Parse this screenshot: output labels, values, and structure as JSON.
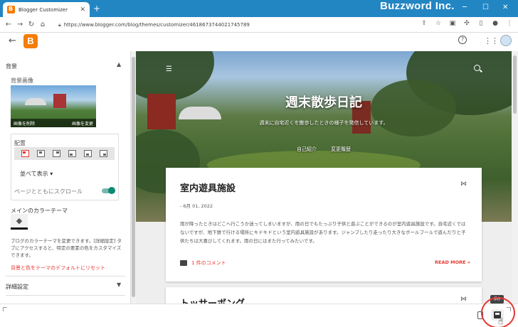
{
  "browser": {
    "tab_title": "Blogger Customizer",
    "tab_close": "✕",
    "new_tab": "+",
    "brand_overlay": "Buzzword Inc.",
    "url": "https://www.blogger.com/blog/themes/customizer/4618673744021745789"
  },
  "panel": {
    "background_section": "背景",
    "background_image_label": "背景画像",
    "remove_image": "画像を削除",
    "change_image": "画像を変更",
    "placement_label": "配置",
    "arrange_select": "並べて表示 ▾",
    "scroll_with_page": "ページとともにスクロール",
    "main_color_theme": "メインのカラーテーマ",
    "theme_description": "ブログのカラーテーマを変更できます。[詳細設定] タブにアクセスすると、特定の要素の色をカスタマイズできます。",
    "reset_link": "背景と色をテーマのデフォルトにリセット",
    "advanced_section": "詳細設定"
  },
  "preview": {
    "blog_title": "週末散歩日記",
    "blog_description": "週末に自宅近くを散歩したときの様子を発信しています。",
    "nav": [
      "自己紹介",
      "変更履歴"
    ],
    "post1": {
      "title": "室内遊具施設",
      "date": "- 6月 01, 2022",
      "body": "雨が降ったときはどこへ行こうか迷ってしまいますが、雨の日でもたっぷり子供と遊ぶことができるのが室内遊具施設です。自宅近くではないですが、地下鉄で行ける場所にキドキドという室内遊具施設があります。ジャンプしたり走ったり大きなボールプールで遊んだりと子供たちは大喜びしてくれます。雨の日にはまた行ってみたいです。",
      "comments": "1 件のコメント",
      "read_more": "READ MORE »"
    },
    "post2": {
      "title": "トッサーボング"
    }
  },
  "bottom": {
    "save_tooltip": "保存"
  },
  "colors": {
    "accent_red": "#e53935",
    "toggle_teal": "#0b8a73",
    "blogger_orange": "#f57d00",
    "titlebar_blue": "#2286c3"
  }
}
